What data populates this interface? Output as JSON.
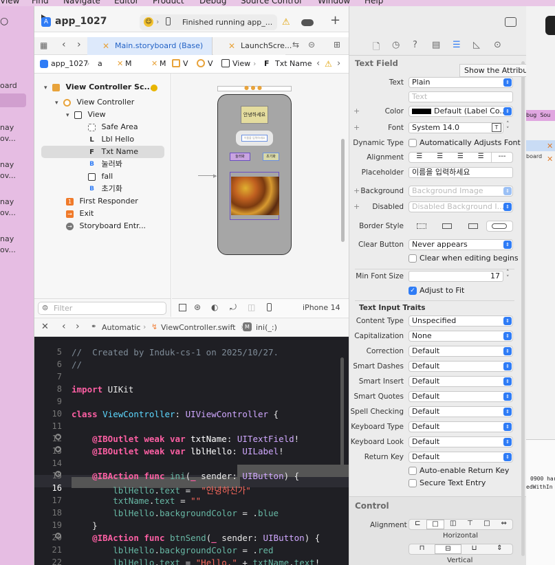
{
  "menubar": {
    "items": [
      "View",
      "Find",
      "Navigate",
      "Editor",
      "Product",
      "Debug",
      "Source Control",
      "Window",
      "Help"
    ]
  },
  "bg_left": {
    "lines": [
      "oard",
      "nay",
      "ov...",
      "nay",
      "ov...",
      "nay",
      "ov...",
      "nay",
      "ov..."
    ]
  },
  "bg_right": {
    "lines": [
      "bug",
      "Sou",
      "board",
      "0900 har",
      "edWithIn"
    ]
  },
  "toolbar": {
    "project_name": "app_1027",
    "status_text": "Finished running app_...",
    "add_label": "+"
  },
  "tabs": [
    {
      "label": "Main.storyboard (Base)",
      "active": true
    },
    {
      "label": "LaunchScre...",
      "active": false
    }
  ],
  "jumpbar": {
    "items": [
      "app_1027",
      "a",
      "M",
      "M",
      "V",
      "V",
      "V",
      "View",
      "Txt Name"
    ]
  },
  "navigator": {
    "scene_title": "View Controller Sc...",
    "rows": [
      {
        "label": "View Controller",
        "indent": 1,
        "icon": "view-controller-icon"
      },
      {
        "label": "View",
        "indent": 2,
        "icon": "view-icon"
      },
      {
        "label": "Safe Area",
        "indent": 3,
        "icon": "safe-area-icon"
      },
      {
        "label": "Lbl Hello",
        "indent": 3,
        "icon": "label-icon"
      },
      {
        "label": "Txt Name",
        "indent": 3,
        "icon": "textfield-icon",
        "selected": true
      },
      {
        "label": "눌러봐",
        "indent": 3,
        "icon": "button-icon"
      },
      {
        "label": "fall",
        "indent": 3,
        "icon": "imageview-icon"
      },
      {
        "label": "초기화",
        "indent": 3,
        "icon": "button-icon"
      },
      {
        "label": "First Responder",
        "indent": 1,
        "icon": "first-responder-icon"
      },
      {
        "label": "Exit",
        "indent": 1,
        "icon": "exit-icon"
      },
      {
        "label": "Storyboard Entr...",
        "indent": 1,
        "icon": "storyboard-entry-icon"
      }
    ],
    "filter_placeholder": "Filter"
  },
  "canvas": {
    "label_text": "안녕하세요",
    "textfield_text": "이름을 입력하세요",
    "button1": "눌러봐",
    "button2": "초기화",
    "device_label": "iPhone 14"
  },
  "editor_bar": {
    "mode": "Automatic",
    "file": "ViewController.swift",
    "symbol": "ini(_:)"
  },
  "code": {
    "line_numbers": [
      "5",
      "6",
      "7",
      "8",
      "9",
      "10",
      "11",
      "12",
      "13",
      "14",
      "15",
      "16",
      "17",
      "18",
      "19",
      "20",
      "21",
      "22"
    ],
    "current_line": "16"
  },
  "inspector": {
    "section_title": "Text Field",
    "tooltip": "Show the Attributes inspe",
    "text_type": "Plain",
    "text_placeholder": "Text",
    "color": "Default (Label Co...",
    "font": "System 14.0",
    "dynamic_type_label": "Automatically Adjusts Font",
    "placeholder": "이름을 입력하세요",
    "background_placeholder": "Background Image",
    "disabled_placeholder": "Disabled Background I...",
    "clear_button": "Never appears",
    "clear_when_editing": "Clear when editing begins",
    "min_font_size": "17",
    "adjust_to_fit": "Adjust to Fit",
    "traits_title": "Text Input Traits",
    "traits": [
      {
        "label": "Content Type",
        "value": "Unspecified"
      },
      {
        "label": "Capitalization",
        "value": "None"
      },
      {
        "label": "Correction",
        "value": "Default"
      },
      {
        "label": "Smart Dashes",
        "value": "Default"
      },
      {
        "label": "Smart Insert",
        "value": "Default"
      },
      {
        "label": "Smart Quotes",
        "value": "Default"
      },
      {
        "label": "Spell Checking",
        "value": "Default"
      },
      {
        "label": "Keyboard Type",
        "value": "Default"
      },
      {
        "label": "Keyboard Look",
        "value": "Default"
      },
      {
        "label": "Return Key",
        "value": "Default"
      }
    ],
    "auto_enable": "Auto-enable Return Key",
    "secure": "Secure Text Entry",
    "control_title": "Control",
    "alignment_label": "Alignment",
    "horizontal_label": "Horizontal",
    "vertical_label": "Vertical",
    "labels": {
      "text": "Text",
      "color": "Color",
      "font": "Font",
      "dynamic_type": "Dynamic Type",
      "alignment": "Alignment",
      "placeholder": "Placeholder",
      "background": "Background",
      "disabled": "Disabled",
      "border_style": "Border Style",
      "clear_button": "Clear Button",
      "min_font_size": "Min Font Size"
    }
  }
}
